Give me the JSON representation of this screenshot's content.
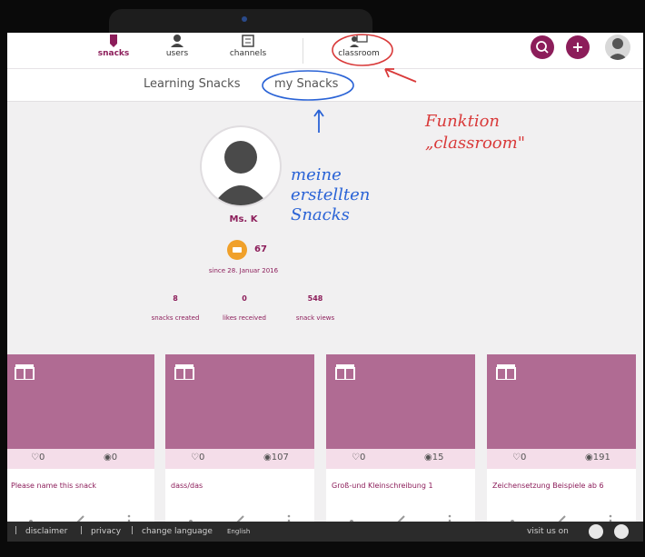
{
  "header": {
    "nav": [
      {
        "label": "snacks",
        "icon": "snack-icon",
        "active": true
      },
      {
        "label": "users",
        "icon": "users-icon",
        "active": false
      },
      {
        "label": "channels",
        "icon": "channels-icon",
        "active": false
      },
      {
        "label": "classroom",
        "icon": "classroom-icon",
        "active": false
      }
    ],
    "add_label": "+"
  },
  "subnav": {
    "tabs": [
      "Learning Snacks",
      "my Snacks"
    ]
  },
  "profile": {
    "name": "Ms. K",
    "points": "67",
    "since": "since 28. Januar 2016",
    "stats": [
      {
        "value": "8",
        "label": "snacks created"
      },
      {
        "value": "0",
        "label": "likes received"
      },
      {
        "value": "548",
        "label": "snack views"
      }
    ]
  },
  "cards": [
    {
      "likes": "0",
      "views": "0",
      "title": "Please name this snack"
    },
    {
      "likes": "0",
      "views": "107",
      "title": "dass/das"
    },
    {
      "likes": "0",
      "views": "15",
      "title": "Groß-und Kleinschreibung 1"
    },
    {
      "likes": "0",
      "views": "191",
      "title": "Zeichensetzung Beispiele ab 6"
    }
  ],
  "footer": {
    "links": [
      "disclaimer",
      "privacy",
      "change language"
    ],
    "language": "English",
    "visit": "visit us on"
  },
  "annotations": {
    "red": [
      "Funktion",
      "„classroom\""
    ],
    "blue": [
      "meine",
      "erstellten",
      "Snacks"
    ]
  },
  "colors": {
    "brand": "#8c1d5a",
    "card_image": "#b06b93",
    "card_meta": "#f4dde9",
    "badge": "#f0a02a",
    "annotation_red": "#d93a3a",
    "annotation_blue": "#2a63d6"
  }
}
